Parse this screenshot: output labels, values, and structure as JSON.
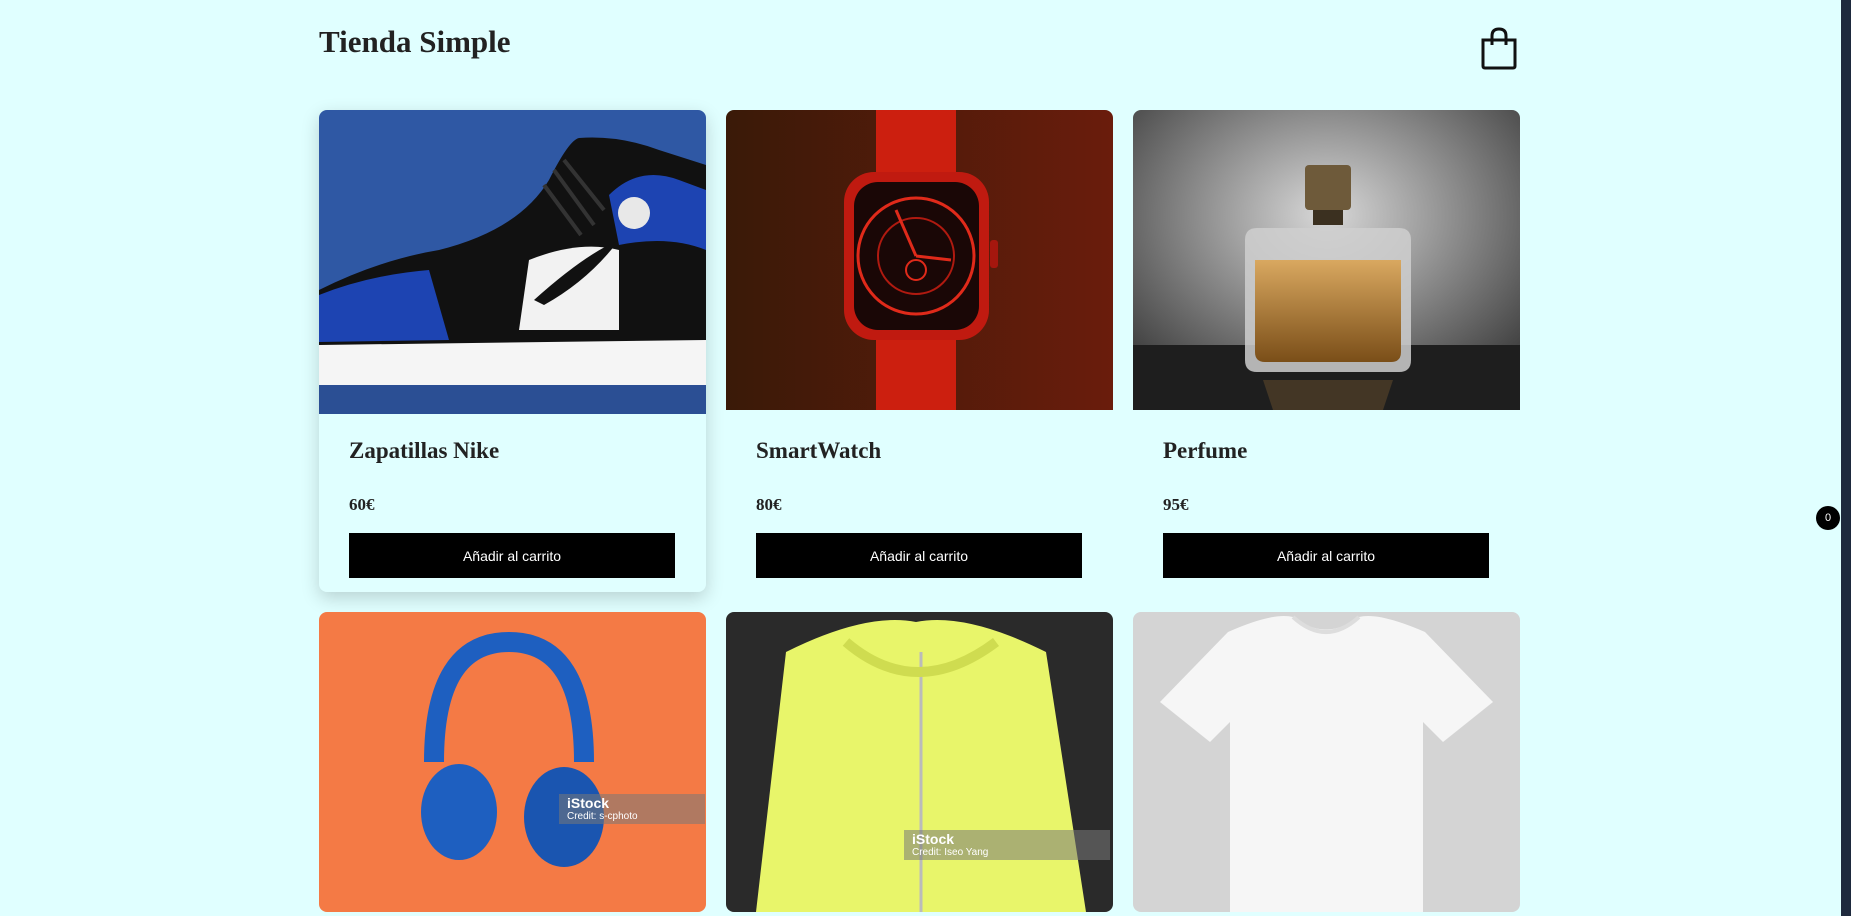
{
  "header": {
    "title": "Tienda Simple"
  },
  "cart": {
    "count": "0"
  },
  "products": [
    {
      "name": "Zapatillas Nike",
      "price": "60€",
      "button": "Añadir al carrito"
    },
    {
      "name": "SmartWatch",
      "price": "80€",
      "button": "Añadir al carrito"
    },
    {
      "name": "Perfume",
      "price": "95€",
      "button": "Añadir al carrito"
    }
  ],
  "row2": [
    {
      "watermark_brand": "iStock",
      "watermark_credit": "Credit: s-cphoto"
    },
    {
      "watermark_brand": "iStock",
      "watermark_credit": "Credit: Iseo Yang"
    },
    {}
  ],
  "icons": {
    "cart": "shopping-bag-icon"
  },
  "colors": {
    "background": "#e0ffff",
    "button": "#000000",
    "button_text": "#ffffff"
  }
}
